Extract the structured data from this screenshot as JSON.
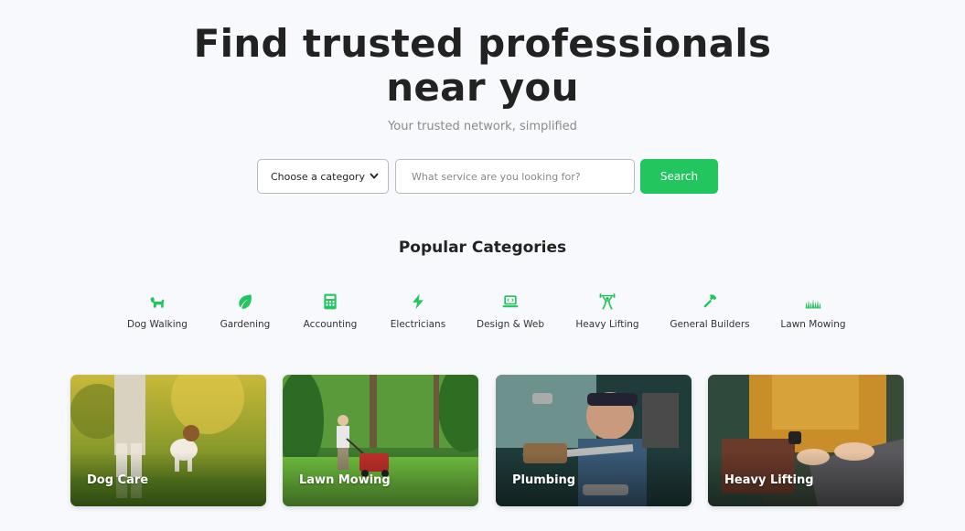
{
  "hero": {
    "title_line1": "Find trusted professionals",
    "title_line2": "near you",
    "subtitle": "Your trusted network, simplified"
  },
  "search": {
    "category_selected": "Choose a category",
    "placeholder": "What service are you looking for?",
    "button_label": "Search"
  },
  "popular": {
    "heading": "Popular Categories",
    "accent_color": "#22c55e",
    "items": [
      {
        "label": "Dog Walking",
        "icon": "dog-icon"
      },
      {
        "label": "Gardening",
        "icon": "leaf-icon"
      },
      {
        "label": "Accounting",
        "icon": "calculator-icon"
      },
      {
        "label": "Electricians",
        "icon": "bolt-icon"
      },
      {
        "label": "Design & Web",
        "icon": "laptop-code-icon"
      },
      {
        "label": "Heavy Lifting",
        "icon": "weightlifter-icon"
      },
      {
        "label": "General Builders",
        "icon": "hammer-icon"
      },
      {
        "label": "Lawn Mowing",
        "icon": "grass-icon"
      }
    ]
  },
  "featured": [
    {
      "label": "Dog Care",
      "image": "dog-walking-photo"
    },
    {
      "label": "Lawn Mowing",
      "image": "lawn-mower-photo"
    },
    {
      "label": "Plumbing",
      "image": "plumber-photo"
    },
    {
      "label": "Heavy Lifting",
      "image": "laptop-typing-photo"
    }
  ]
}
